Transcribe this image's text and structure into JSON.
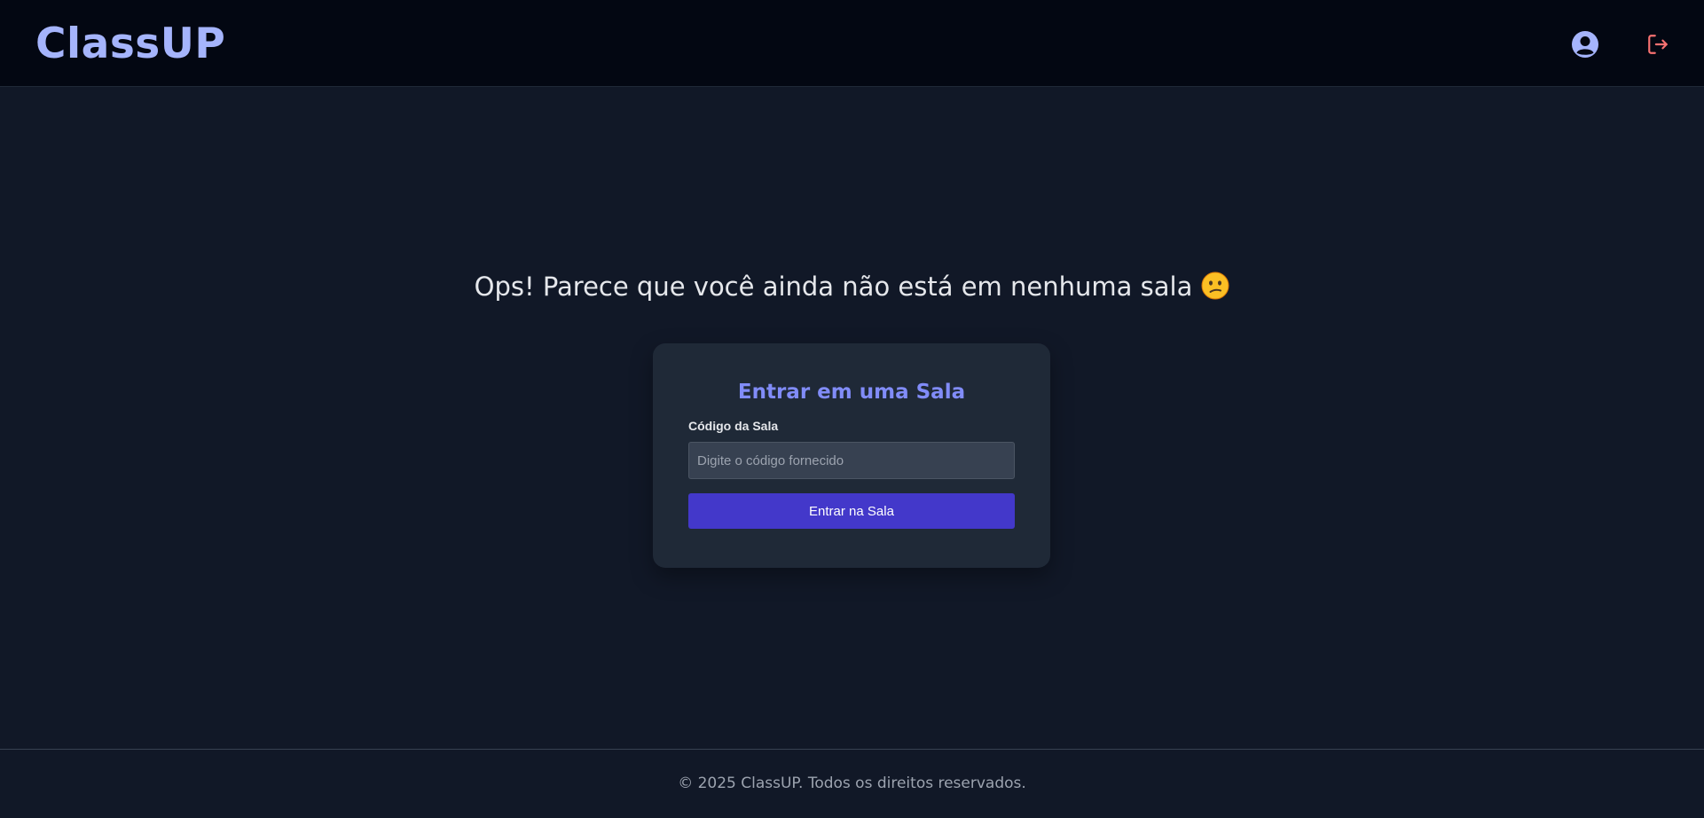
{
  "header": {
    "logo": "ClassUP",
    "profile_icon": "user-circle-icon",
    "logout_icon": "logout-icon"
  },
  "main": {
    "headline": "Ops! Parece que você ainda não está em nenhuma sala",
    "headline_emoji": "confused-face-icon",
    "join_card": {
      "title": "Entrar em uma Sala",
      "code_label": "Código da Sala",
      "code_placeholder": "Digite o código fornecido",
      "code_value": "",
      "submit_label": "Entrar na Sala"
    }
  },
  "footer": {
    "text": "© 2025 ClassUP. Todos os direitos reservados."
  },
  "colors": {
    "page_bg": "#111827",
    "header_bg": "#030712",
    "logo": "#a5b4fc",
    "card_bg": "#1f2937",
    "card_title": "#818cf8",
    "button_bg": "#4338ca",
    "logout": "#f87171"
  }
}
